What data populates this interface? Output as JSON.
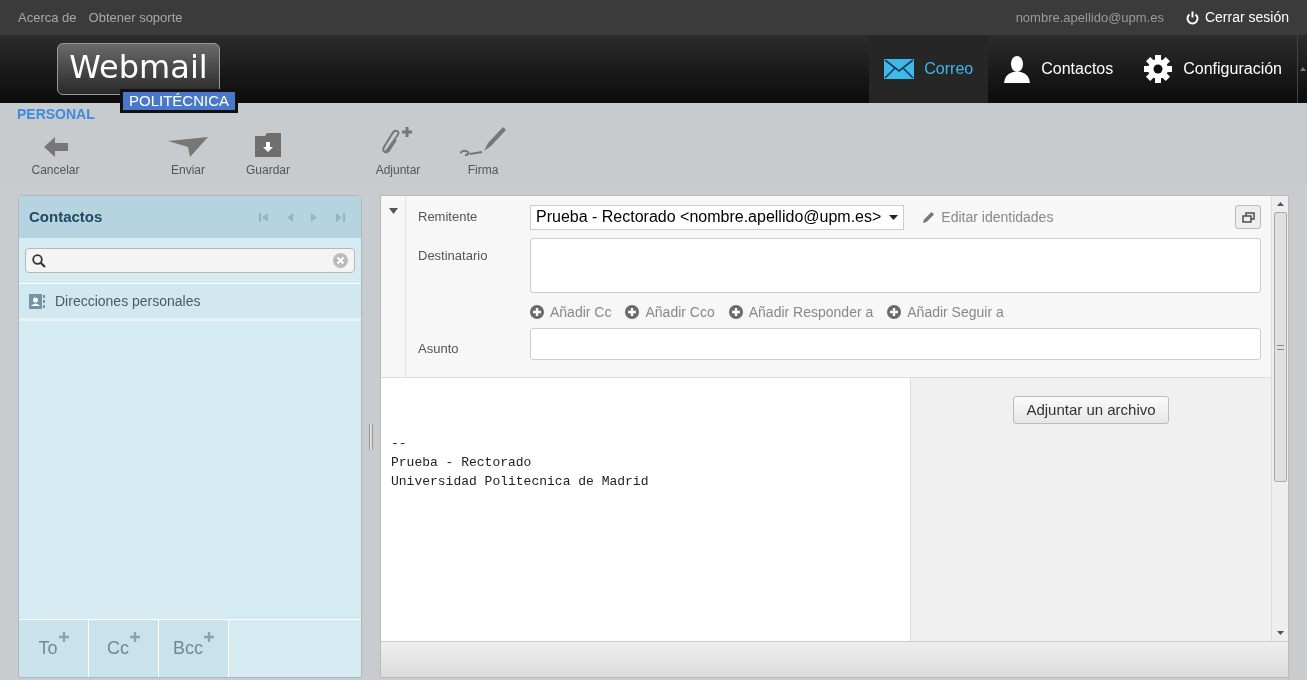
{
  "top_links": [
    "Acerca de",
    "Obtener soporte"
  ],
  "user": "nombre.apellido@upm.es",
  "logout": "Cerrar sesión",
  "logo": {
    "title": "Webmail",
    "badge": "POLITÉCNICA",
    "tag": "PERSONAL"
  },
  "nav_tabs": [
    {
      "label": "Correo",
      "selected": true
    },
    {
      "label": "Contactos",
      "selected": false
    },
    {
      "label": "Configuración",
      "selected": false
    }
  ],
  "toolbar": [
    "Cancelar",
    "Enviar",
    "Guardar",
    "Adjuntar",
    "Firma"
  ],
  "contacts": {
    "title": "Contactos",
    "items": [
      {
        "label": "Direcciones personales"
      }
    ],
    "footer_buttons": [
      "To",
      "Cc",
      "Bcc"
    ]
  },
  "compose": {
    "sender_label": "Remitente",
    "sender_value": "Prueba - Rectorado <nombre.apellido@upm.es>",
    "edit_identities": "Editar identidades",
    "to_label": "Destinatario",
    "add_links": [
      "Añadir Cc",
      "Añadir Cco",
      "Añadir Responder a",
      "Añadir Seguir a"
    ],
    "subject_label": "Asunto",
    "body_lines": [
      "--",
      "Prueba - Rectorado",
      "Universidad Politecnica de Madrid"
    ],
    "attach_button": "Adjuntar un archivo"
  }
}
